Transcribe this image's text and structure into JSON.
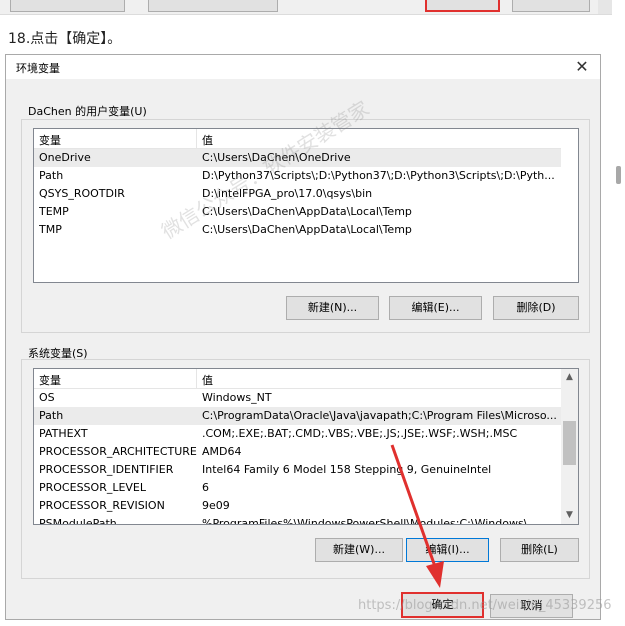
{
  "step": {
    "title": "18.点击【确定】。"
  },
  "dialog": {
    "title": "环境变量",
    "close_symbol": "✕"
  },
  "user_vars": {
    "group_label": "DaChen 的用户变量(U)",
    "columns": [
      "变量",
      "值"
    ],
    "rows": [
      {
        "name": "OneDrive",
        "value": "C:\\Users\\DaChen\\OneDrive"
      },
      {
        "name": "Path",
        "value": "D:\\Python37\\Scripts\\;D:\\Python37\\;D:\\Python3\\Scripts\\;D:\\Pyth..."
      },
      {
        "name": "QSYS_ROOTDIR",
        "value": "D:\\intelFPGA_pro\\17.0\\qsys\\bin"
      },
      {
        "name": "TEMP",
        "value": "C:\\Users\\DaChen\\AppData\\Local\\Temp"
      },
      {
        "name": "TMP",
        "value": "C:\\Users\\DaChen\\AppData\\Local\\Temp"
      }
    ],
    "buttons": {
      "new": "新建(N)...",
      "edit": "编辑(E)...",
      "delete": "删除(D)"
    }
  },
  "system_vars": {
    "group_label": "系统变量(S)",
    "columns": [
      "变量",
      "值"
    ],
    "rows": [
      {
        "name": "OS",
        "value": "Windows_NT"
      },
      {
        "name": "Path",
        "value": "C:\\ProgramData\\Oracle\\Java\\javapath;C:\\Program Files\\Microso..."
      },
      {
        "name": "PATHEXT",
        "value": ".COM;.EXE;.BAT;.CMD;.VBS;.VBE;.JS;.JSE;.WSF;.WSH;.MSC"
      },
      {
        "name": "PROCESSOR_ARCHITECTURE",
        "value": "AMD64"
      },
      {
        "name": "PROCESSOR_IDENTIFIER",
        "value": "Intel64 Family 6 Model 158 Stepping 9, GenuineIntel"
      },
      {
        "name": "PROCESSOR_LEVEL",
        "value": "6"
      },
      {
        "name": "PROCESSOR_REVISION",
        "value": "9e09"
      },
      {
        "name": "PSModulePath",
        "value": "%ProgramFiles%\\WindowsPowerShell\\Modules;C:\\Windows\\..."
      }
    ],
    "buttons": {
      "new": "新建(W)...",
      "edit": "编辑(I)...",
      "delete": "删除(L)"
    }
  },
  "footer": {
    "ok": "确定",
    "cancel": "取消"
  },
  "watermark": {
    "text": "微信公众号：软件安装管家",
    "csdn": "https://blog.csdn.net/weixin_45339256"
  },
  "colors": {
    "highlight": "#e0302e",
    "focus": "#0078d7"
  }
}
